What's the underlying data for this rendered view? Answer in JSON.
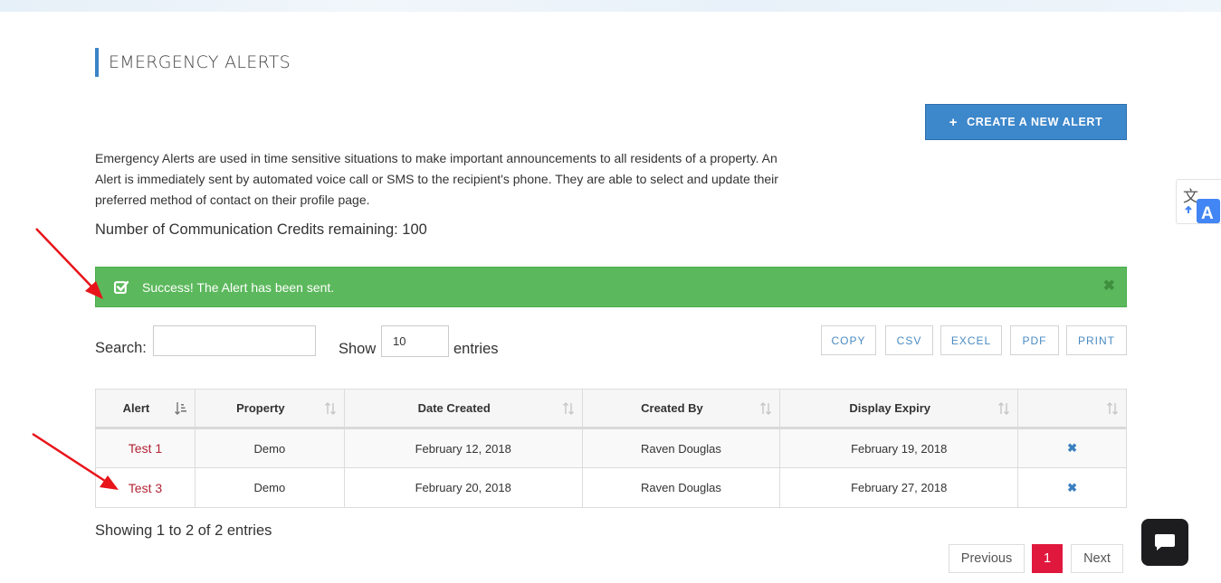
{
  "page": {
    "title": "EMERGENCY ALERTS",
    "create_button_label": "CREATE A NEW ALERT",
    "description": "Emergency Alerts are used in time sensitive situations to make important announcements to all residents of a property. An Alert is immediately sent by automated voice call or SMS to the recipient's phone. They are able to select and update their preferred method of contact on their profile page.",
    "credits_text": "Number of Communication Credits remaining: 100"
  },
  "alert": {
    "message": "Success! The Alert has been sent.",
    "close_glyph": "✖"
  },
  "controls": {
    "search_label": "Search:",
    "search_value": "",
    "show_label": "Show",
    "show_value": "10",
    "entries_label": "entries",
    "export_buttons": [
      "COPY",
      "CSV",
      "EXCEL",
      "PDF",
      "PRINT"
    ]
  },
  "table": {
    "columns": [
      "Alert",
      "Property",
      "Date Created",
      "Created By",
      "Display Expiry",
      ""
    ],
    "rows": [
      {
        "alert": "Test 1",
        "property": "Demo",
        "date_created": "February 12, 2018",
        "created_by": "Raven Douglas",
        "display_expiry": "February 19, 2018"
      },
      {
        "alert": "Test 3",
        "property": "Demo",
        "date_created": "February 20, 2018",
        "created_by": "Raven Douglas",
        "display_expiry": "February 27, 2018"
      }
    ],
    "delete_glyph": "✖"
  },
  "footer": {
    "showing_text": "Showing 1 to 2 of 2 entries",
    "pagination": {
      "previous": "Previous",
      "current": "1",
      "next": "Next"
    }
  },
  "colors": {
    "accent_blue": "#3d87cb",
    "success_green": "#5cb85c",
    "link_red": "#b22234",
    "active_page": "#e0183e",
    "annotation_arrow": "#e8141a"
  },
  "icons": {
    "create": "plus-icon",
    "alert": "check-square-icon",
    "close": "close-icon",
    "sort_active": "sort-amount-asc-icon",
    "sort": "sort-arrows-icon",
    "delete": "delete-icon",
    "translate": "google-translate-icon",
    "chat": "chat-bubble-icon"
  }
}
